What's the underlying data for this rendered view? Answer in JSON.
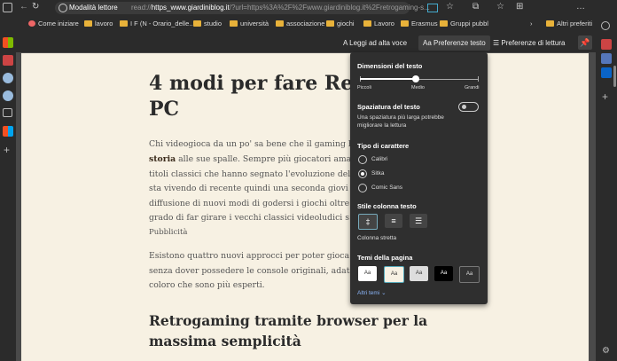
{
  "browser": {
    "tab_label": "Modalità lettore",
    "url_prefix": "read://",
    "url_domain": "https_www.giardiniblog.it",
    "url_rest": "/?url=https%3A%2F%2Fwww.giardiniblog.it%2Fretrogaming-s..."
  },
  "favorites": [
    {
      "label": "Come iniziare"
    },
    {
      "label": "lavoro"
    },
    {
      "label": "I F (N - Orario_delle..."
    },
    {
      "label": "studio"
    },
    {
      "label": "università"
    },
    {
      "label": "associazione"
    },
    {
      "label": "giochi"
    },
    {
      "label": "Lavoro"
    },
    {
      "label": "Erasmus"
    },
    {
      "label": "Gruppi pubbl"
    }
  ],
  "favorites_other": "Altri preferiti",
  "toolbar": {
    "read_aloud": "Leggi ad alta voce",
    "text_prefs": "Preferenze testo",
    "reading_prefs": "Preferenze di lettura"
  },
  "article": {
    "title_line1": "4 modi per fare Retro",
    "title_line2": "PC",
    "p1": [
      "Chi videogioca da un po' sa bene che il gaming h",
      "storia alle sue spalle. Sempre più giocatori ama",
      "titoli classici che hanno segnato l'evoluzione del",
      "sta vivendo di recente quindi una seconda giovi",
      "diffusione di nuovi modi di godersi i giochi oltre",
      "grado di far girare i vecchi classici videoludici s",
      "Pubblicità"
    ],
    "p1_bold": "storia",
    "p2": [
      "Esistono quattro nuovi approcci per poter gioca",
      "senza dover possedere le console originali, adat",
      "coloro che sono più esperti."
    ],
    "h2_line1": "Retrogaming tramite browser per la",
    "h2_line2": "massima semplicità"
  },
  "panel": {
    "text_size_title": "Dimensioni del testo",
    "size_small": "Piccoli",
    "size_medium": "Medio",
    "size_large": "Grandi",
    "text_size_value": 0.47,
    "spacing_title": "Spaziatura del testo",
    "spacing_desc1": "Una spaziatura più larga potrebbe",
    "spacing_desc2": "migliorare la lettura",
    "font_title": "Tipo di carattere",
    "fonts": [
      "Calibri",
      "Sitka",
      "Comic Sans"
    ],
    "font_selected": "Sitka",
    "column_title": "Stile colonna testo",
    "column_selected_label": "Colonna stretta",
    "theme_title": "Temi della pagina",
    "theme_label": "Aa",
    "more_themes": "Altri temi"
  }
}
